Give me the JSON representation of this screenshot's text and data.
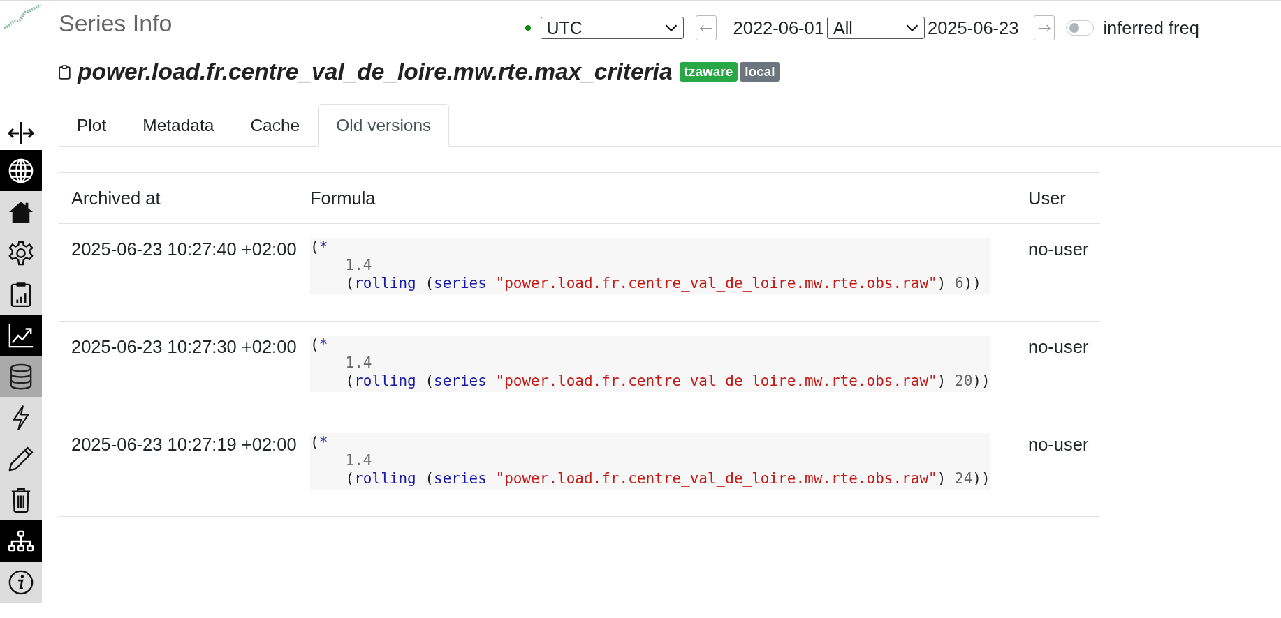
{
  "header": {
    "title": "Series Info",
    "series_name": "power.load.fr.centre_val_de_loire.mw.rte.max_criteria",
    "badges": [
      {
        "label": "tzaware",
        "color": "#28a745"
      },
      {
        "label": "local",
        "color": "#6c757d"
      }
    ]
  },
  "controls": {
    "online": true,
    "timezone": "UTC",
    "from_date": "2022-06-01",
    "range": "All",
    "to_date": "2025-06-23",
    "inferred_freq": {
      "label": "inferred freq",
      "on": false
    }
  },
  "sidebar": {
    "items": [
      {
        "kind": "globe",
        "active": true,
        "hovered": false
      },
      {
        "kind": "home",
        "active": false,
        "hovered": false
      },
      {
        "kind": "gear",
        "active": false,
        "hovered": false
      },
      {
        "kind": "clipboard",
        "active": false,
        "hovered": false
      },
      {
        "kind": "chart",
        "active": true,
        "hovered": false
      },
      {
        "kind": "database",
        "active": false,
        "hovered": true
      },
      {
        "kind": "bolt",
        "active": false,
        "hovered": false
      },
      {
        "kind": "pencil",
        "active": false,
        "hovered": false
      },
      {
        "kind": "trash",
        "active": false,
        "hovered": false
      },
      {
        "kind": "sitemap",
        "active": true,
        "hovered": false
      },
      {
        "kind": "info",
        "active": false,
        "hovered": false
      }
    ]
  },
  "tabs": [
    {
      "label": "Plot",
      "selected": false
    },
    {
      "label": "Metadata",
      "selected": false
    },
    {
      "label": "Cache",
      "selected": false
    },
    {
      "label": "Old versions",
      "selected": true
    }
  ],
  "table": {
    "columns": [
      "Archived at",
      "Formula",
      "User"
    ],
    "rows": [
      {
        "archived_at": "2025-06-23 10:27:40 +02:00",
        "user": "no-user",
        "formula": [
          [
            {
              "kind": "punct",
              "text": "("
            },
            {
              "kind": "operator",
              "text": "*"
            }
          ],
          [
            {
              "kind": "number",
              "text": "    1.4"
            }
          ],
          [
            {
              "kind": "punct",
              "text": "    ("
            },
            {
              "kind": "operator",
              "text": "rolling"
            },
            {
              "kind": "punct",
              "text": " ("
            },
            {
              "kind": "operator",
              "text": "series"
            },
            {
              "kind": "string",
              "text": " \"power.load.fr.centre_val_de_loire.mw.rte.obs.raw\""
            },
            {
              "kind": "punct",
              "text": ")"
            },
            {
              "kind": "number",
              "text": " 6"
            },
            {
              "kind": "punct",
              "text": "))"
            }
          ]
        ]
      },
      {
        "archived_at": "2025-06-23 10:27:30 +02:00",
        "user": "no-user",
        "formula": [
          [
            {
              "kind": "punct",
              "text": "("
            },
            {
              "kind": "operator",
              "text": "*"
            }
          ],
          [
            {
              "kind": "number",
              "text": "    1.4"
            }
          ],
          [
            {
              "kind": "punct",
              "text": "    ("
            },
            {
              "kind": "operator",
              "text": "rolling"
            },
            {
              "kind": "punct",
              "text": " ("
            },
            {
              "kind": "operator",
              "text": "series"
            },
            {
              "kind": "string",
              "text": " \"power.load.fr.centre_val_de_loire.mw.rte.obs.raw\""
            },
            {
              "kind": "punct",
              "text": ")"
            },
            {
              "kind": "number",
              "text": " 20"
            },
            {
              "kind": "punct",
              "text": "))"
            }
          ]
        ]
      },
      {
        "archived_at": "2025-06-23 10:27:19 +02:00",
        "user": "no-user",
        "formula": [
          [
            {
              "kind": "punct",
              "text": "("
            },
            {
              "kind": "operator",
              "text": "*"
            }
          ],
          [
            {
              "kind": "number",
              "text": "    1.4"
            }
          ],
          [
            {
              "kind": "punct",
              "text": "    ("
            },
            {
              "kind": "operator",
              "text": "rolling"
            },
            {
              "kind": "punct",
              "text": " ("
            },
            {
              "kind": "operator",
              "text": "series"
            },
            {
              "kind": "string",
              "text": " \"power.load.fr.centre_val_de_loire.mw.rte.obs.raw\""
            },
            {
              "kind": "punct",
              "text": ")"
            },
            {
              "kind": "number",
              "text": " 24"
            },
            {
              "kind": "punct",
              "text": "))"
            }
          ]
        ]
      }
    ]
  }
}
